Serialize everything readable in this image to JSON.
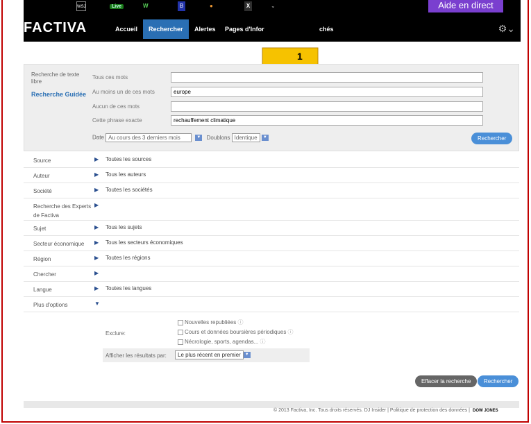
{
  "topbar": {
    "icons": [
      "wsj-icon",
      "live-icon",
      "w-icon",
      "b-icon",
      "color-icon",
      "x-icon",
      "chevron-down-icon"
    ],
    "live_label": "Live",
    "help_label": "Aide en direct"
  },
  "navbar": {
    "logo": "FACTIVA",
    "items": [
      "Accueil",
      "Rechercher",
      "Alertes",
      "Pages d'Infor",
      "chés"
    ],
    "active": "Rechercher"
  },
  "callout": {
    "number": "1"
  },
  "search": {
    "tabs": [
      "Recherche de texte libre",
      "Recherche Guidée"
    ],
    "fields": [
      {
        "label": "Tous ces mots",
        "value": ""
      },
      {
        "label": "Au moins un de ces mots",
        "value": "europe"
      },
      {
        "label": "Aucun de ces mots",
        "value": ""
      },
      {
        "label": "Cette phrase exacte",
        "value": "rechauffement climatique"
      }
    ],
    "date_label": "Date",
    "date_value": "Au cours des 3 derniers mois",
    "dup_label": "Doublons",
    "dup_value": "Identique",
    "search_button": "Rechercher"
  },
  "filters": [
    {
      "label": "Source",
      "value": "Toutes les sources"
    },
    {
      "label": "Auteur",
      "value": "Tous les auteurs"
    },
    {
      "label": "Société",
      "value": "Toutes les sociétés"
    },
    {
      "label": "Recherche des Experts de Factiva",
      "value": ""
    },
    {
      "label": "Sujet",
      "value": "Tous les sujets"
    },
    {
      "label": "Secteur économique",
      "value": "Tous les secteurs économiques"
    },
    {
      "label": "Région",
      "value": "Toutes les régions"
    },
    {
      "label": "Chercher",
      "value": ""
    },
    {
      "label": "Langue",
      "value": "Toutes les langues"
    },
    {
      "label": "Plus d'options",
      "value": ""
    }
  ],
  "options": {
    "exclude_label": "Exclure:",
    "excludes": [
      "Nouvelles republiées",
      "Cours et données boursières périodiques",
      "Nécrologie, sports, agendas..."
    ],
    "display_label": "Afficher les résultats par:",
    "display_value": "Le plus récent en premier"
  },
  "actions": {
    "clear_button": "Effacer la recherche",
    "search_button": "Rechercher"
  },
  "footer": {
    "copyright": "© 2013 Factiva, Inc. Tous droits réservés.  DJ Insider | Politique de protection des données |",
    "brand": "DOW JONES"
  },
  "colors": {
    "frame": "#c00000",
    "accent": "#2a6fb4",
    "help": "#7a3fcf"
  }
}
